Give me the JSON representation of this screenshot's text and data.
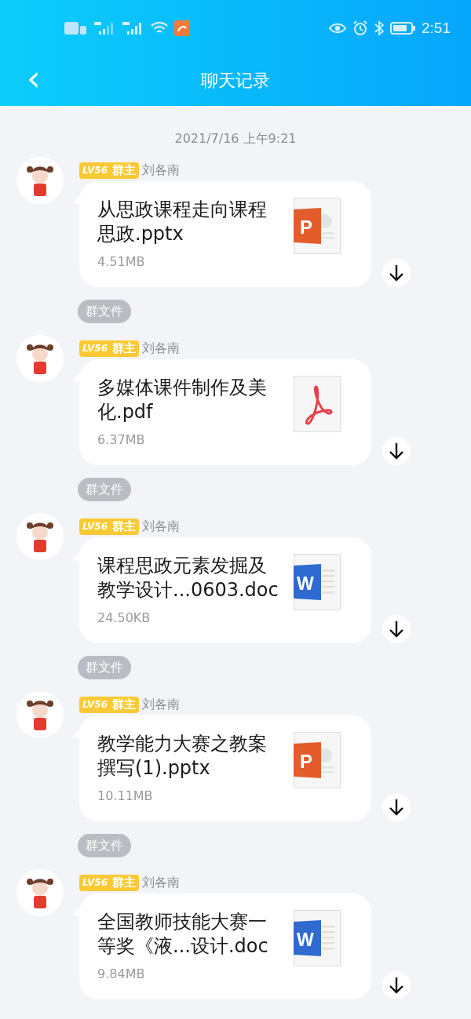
{
  "status_bar": {
    "time": "2:51"
  },
  "header": {
    "title": "聊天记录",
    "back": "‹"
  },
  "date": "2021/7/16 上午9:21",
  "messages": [
    {
      "level_badge": "LV56",
      "role": "群主",
      "sender": "刘各南",
      "file_name": "从思政课程走向课程思政.pptx",
      "file_size": "4.51MB",
      "kind": "ppt",
      "icon_letter": "P",
      "tag": "群文件"
    },
    {
      "level_badge": "LV56",
      "role": "群主",
      "sender": "刘各南",
      "file_name": "多媒体课件制作及美化.pdf",
      "file_size": "6.37MB",
      "kind": "pdf",
      "tag": "群文件"
    },
    {
      "level_badge": "LV56",
      "role": "群主",
      "sender": "刘各南",
      "file_name": "课程思政元素发掘及教学设计...0603.doc",
      "file_size": "24.50KB",
      "kind": "doc",
      "icon_letter": "W",
      "tag": "群文件"
    },
    {
      "level_badge": "LV56",
      "role": "群主",
      "sender": "刘各南",
      "file_name": "教学能力大赛之教案撰写(1).pptx",
      "file_size": "10.11MB",
      "kind": "ppt",
      "icon_letter": "P",
      "tag": "群文件"
    },
    {
      "level_badge": "LV56",
      "role": "群主",
      "sender": "刘各南",
      "file_name": "全国教师技能大赛一等奖《液...设计.doc",
      "file_size": "9.84MB",
      "kind": "doc",
      "icon_letter": "W"
    }
  ]
}
